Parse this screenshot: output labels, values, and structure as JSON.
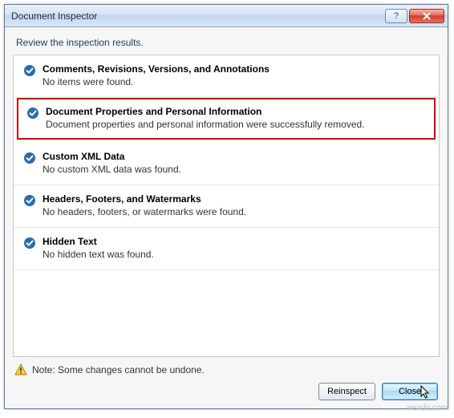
{
  "window": {
    "title": "Document Inspector"
  },
  "intro": "Review the inspection results.",
  "items": [
    {
      "title": "Comments, Revisions, Versions, and Annotations",
      "desc": "No items were found.",
      "highlight": false
    },
    {
      "title": "Document Properties and Personal Information",
      "desc": "Document properties and personal information were successfully removed.",
      "highlight": true
    },
    {
      "title": "Custom XML Data",
      "desc": "No custom XML data was found.",
      "highlight": false
    },
    {
      "title": "Headers, Footers, and Watermarks",
      "desc": "No headers, footers, or watermarks were found.",
      "highlight": false
    },
    {
      "title": "Hidden Text",
      "desc": "No hidden text was found.",
      "highlight": false
    }
  ],
  "note": "Note: Some changes cannot be undone.",
  "buttons": {
    "reinspect": "Reinspect",
    "close": "Close"
  },
  "watermark": "wsxdn.com"
}
